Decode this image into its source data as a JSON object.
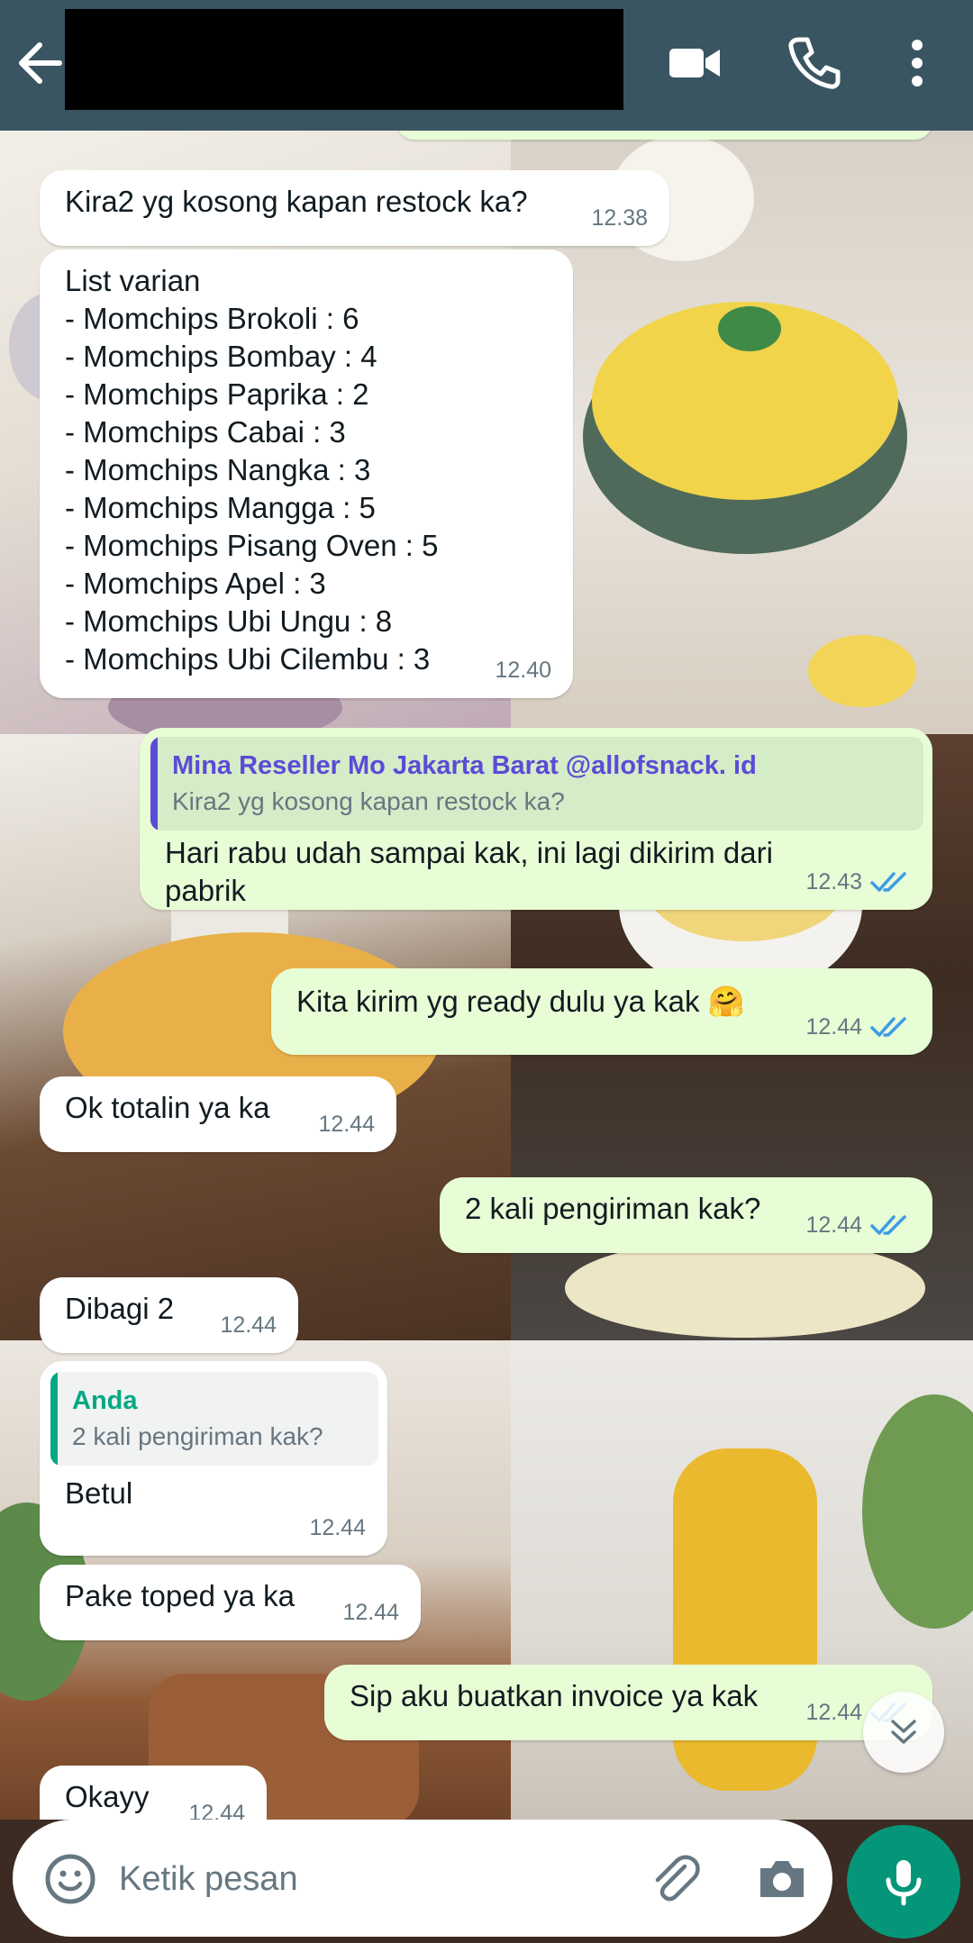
{
  "header": {
    "back_icon": "arrow-left-icon",
    "contact_name_redacted": true,
    "video_icon": "video-camera-icon",
    "call_icon": "phone-icon",
    "menu_icon": "more-vertical-icon",
    "color": "#3a5562"
  },
  "messages": [
    {
      "id": "m1",
      "direction": "incoming",
      "text": "Kira2 yg kosong kapan restock ka?",
      "time": "12.38"
    },
    {
      "id": "m2",
      "direction": "incoming",
      "text": "List varian\n- Momchips Brokoli : 6\n- Momchips Bombay : 4\n- Momchips Paprika : 2\n- Momchips Cabai : 3\n- Momchips Nangka : 3\n- Momchips Mangga : 5\n- Momchips Pisang Oven : 5\n- Momchips Apel : 3\n- Momchips Ubi Ungu : 8\n- Momchips Ubi Cilembu : 3",
      "time": "12.40"
    },
    {
      "id": "m3",
      "direction": "outgoing",
      "quote": {
        "author": "Mina Reseller Mo Jakarta Barat @allofsnack. id",
        "text": "Kira2 yg kosong kapan restock ka?"
      },
      "text": "Hari rabu udah sampai kak, ini lagi dikirim dari pabrik",
      "time": "12.43",
      "status": "read"
    },
    {
      "id": "m4",
      "direction": "outgoing",
      "text": "Kita kirim yg ready dulu ya kak 🤗",
      "time": "12.44",
      "status": "read"
    },
    {
      "id": "m5",
      "direction": "incoming",
      "text": "Ok totalin ya ka",
      "time": "12.44"
    },
    {
      "id": "m6",
      "direction": "outgoing",
      "text": "2 kali pengiriman kak?",
      "time": "12.44",
      "status": "read"
    },
    {
      "id": "m7",
      "direction": "incoming",
      "text": "Dibagi 2",
      "time": "12.44"
    },
    {
      "id": "m8",
      "direction": "incoming",
      "quote": {
        "author": "Anda",
        "text": "2 kali pengiriman kak?"
      },
      "text": "Betul",
      "time": "12.44"
    },
    {
      "id": "m9",
      "direction": "incoming",
      "text": "Pake toped ya ka",
      "time": "12.44"
    },
    {
      "id": "m10",
      "direction": "outgoing",
      "text": "Sip aku buatkan invoice ya kak",
      "time": "12.44",
      "status": "read"
    },
    {
      "id": "m11",
      "direction": "incoming",
      "text": "Okayy",
      "time": "12.44"
    }
  ],
  "scroll_down_icon": "double-chevron-down-icon",
  "composer": {
    "placeholder": "Ketik pesan",
    "emoji_icon": "emoji-icon",
    "attach_icon": "paperclip-icon",
    "camera_icon": "camera-icon",
    "mic_icon": "microphone-icon",
    "mic_color": "#05967a"
  },
  "colors": {
    "incoming_bubble": "#ffffff",
    "outgoing_bubble": "#e7fdd5",
    "read_ticks": "#3d9be9",
    "quote_bar_outgoing": "#5b4bd6",
    "quote_bar_incoming": "#06a884"
  }
}
